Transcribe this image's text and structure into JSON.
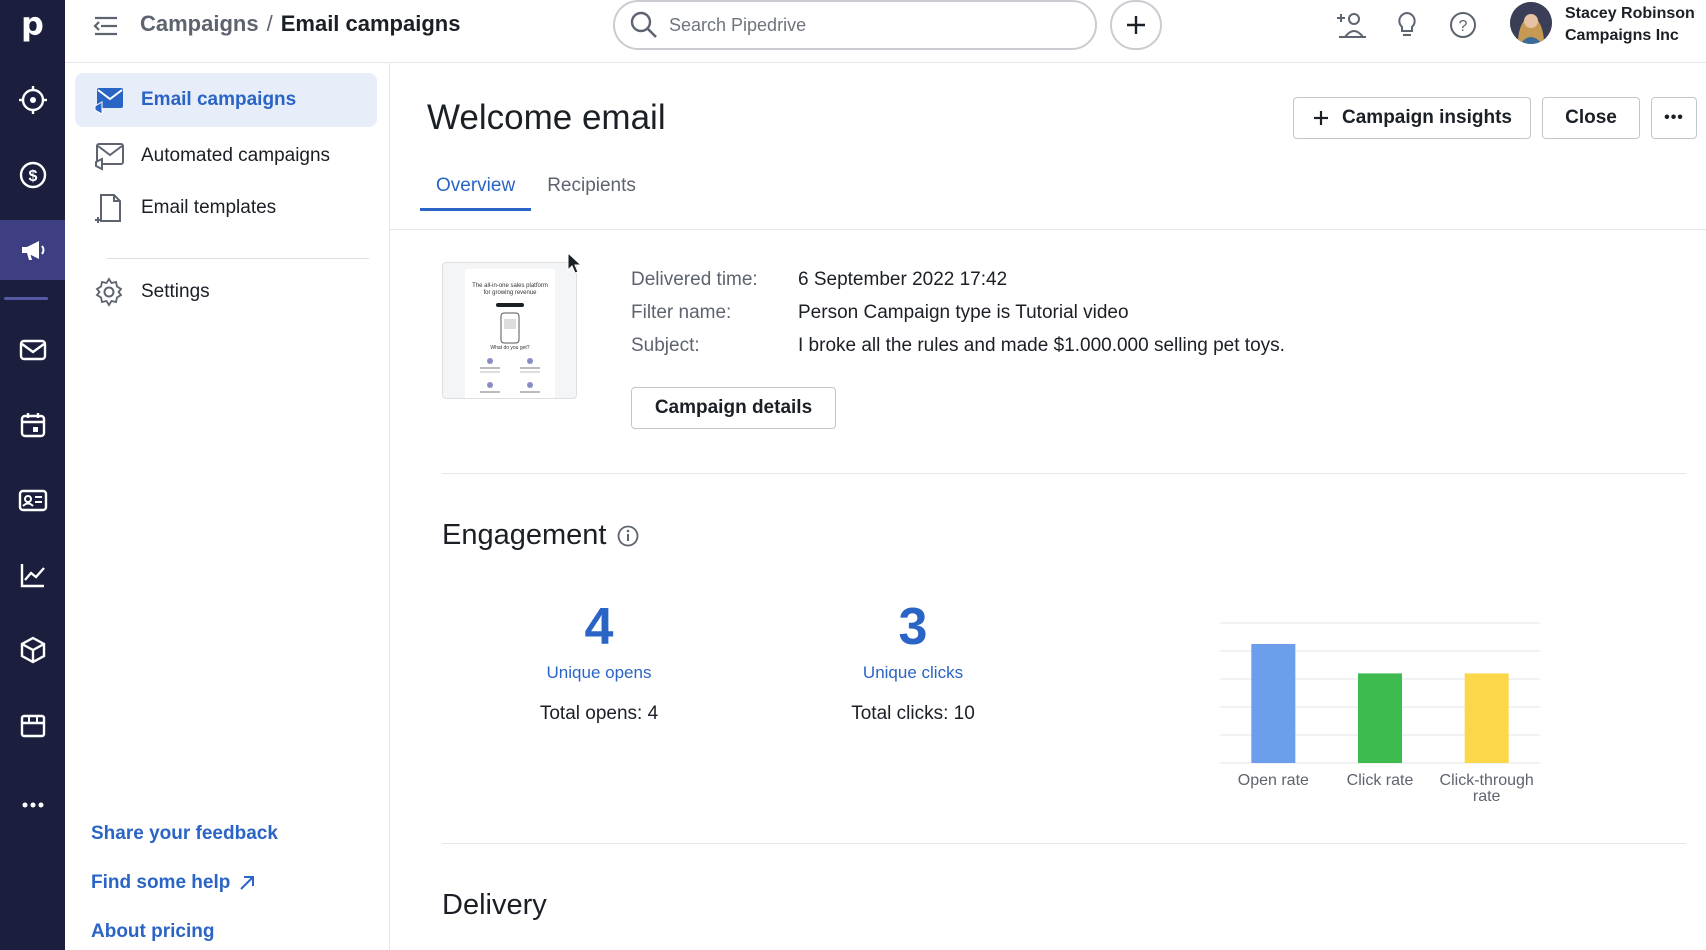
{
  "rail": {
    "logo": "p",
    "items": [
      {
        "icon": "target-icon"
      },
      {
        "icon": "dollar-icon"
      },
      {
        "icon": "megaphone-icon",
        "active": true
      },
      {
        "icon": "mail-icon"
      },
      {
        "icon": "calendar-icon"
      },
      {
        "icon": "contact-card-icon"
      },
      {
        "icon": "chart-line-icon"
      },
      {
        "icon": "box-icon"
      },
      {
        "icon": "store-icon"
      },
      {
        "icon": "more-horizontal-icon"
      }
    ]
  },
  "header": {
    "breadcrumb_parent": "Campaigns",
    "breadcrumb_sep": "/",
    "breadcrumb_current": "Email campaigns",
    "search_placeholder": "Search Pipedrive",
    "user_name": "Stacey Robinson",
    "user_company": "Campaigns Inc"
  },
  "subnav": {
    "items": [
      {
        "label": "Email campaigns",
        "icon": "email-campaign-icon",
        "active": true
      },
      {
        "label": "Automated campaigns",
        "icon": "automated-campaign-icon"
      },
      {
        "label": "Email templates",
        "icon": "template-icon"
      },
      {
        "label": "Settings",
        "icon": "gear-icon"
      }
    ],
    "links": {
      "feedback": "Share your feedback",
      "help": "Find some help",
      "pricing": "About pricing"
    }
  },
  "main": {
    "title": "Welcome email",
    "buttons": {
      "insights": "Campaign insights",
      "close": "Close",
      "more": "•••"
    },
    "tabs": [
      {
        "label": "Overview",
        "active": true
      },
      {
        "label": "Recipients"
      }
    ],
    "thumbnail": {
      "headline": "The all-in-one sales platform for growing revenue",
      "subhead": "What do you get?"
    },
    "details": [
      {
        "label": "Delivered time:",
        "value": "6 September 2022 17:42"
      },
      {
        "label": "Filter name:",
        "value": "Person Campaign type is Tutorial video"
      },
      {
        "label": "Subject:",
        "value": "I broke all the rules and made $1.000.000 selling pet toys."
      }
    ],
    "campaign_details_button": "Campaign details",
    "engagement": {
      "title": "Engagement",
      "unique_opens": "4",
      "unique_opens_label": "Unique opens",
      "total_opens": "Total opens: 4",
      "unique_clicks": "3",
      "unique_clicks_label": "Unique clicks",
      "total_clicks": "Total clicks: 10"
    },
    "delivery_title": "Delivery"
  },
  "chart_data": {
    "type": "bar",
    "categories": [
      "Open rate",
      "Click rate",
      "Click-through rate"
    ],
    "category_lines": [
      [
        "Open rate"
      ],
      [
        "Click rate"
      ],
      [
        "Click-through",
        "rate"
      ]
    ],
    "values": [
      85,
      64,
      64
    ],
    "colors": [
      "#6d9eeb",
      "#3dbb4f",
      "#fdd74a"
    ],
    "ylim": [
      0,
      100
    ],
    "grid": true,
    "title": "",
    "xlabel": "",
    "ylabel": ""
  }
}
